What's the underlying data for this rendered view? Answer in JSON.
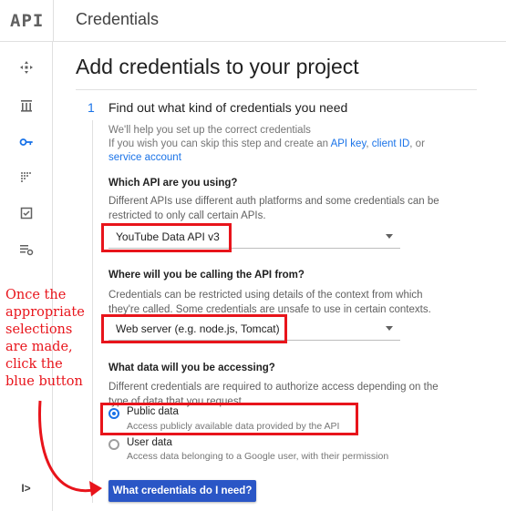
{
  "header": {
    "logo": "API",
    "title": "Credentials"
  },
  "sidebar": {
    "icons": [
      "dashboard-icon",
      "library-icon",
      "key-icon",
      "consent-icon",
      "checkbox-icon",
      "settings-list-icon"
    ],
    "collapse_icon": "collapse-icon",
    "collapse_label": "I>"
  },
  "main": {
    "title": "Add credentials to your project",
    "step": {
      "number": "1",
      "title": "Find out what kind of credentials you need"
    },
    "intro": {
      "line1": "We'll help you set up the correct credentials",
      "line2_prefix": "If you wish you can skip this step and create an",
      "api_key_link": "API key",
      "comma": ",",
      "client_id_link": "client ID",
      "or": ", or",
      "service_account_link": "service account"
    },
    "q1": {
      "label": "Which API are you using?",
      "desc": "Different APIs use different auth platforms and some credentials can be restricted to only call certain APIs.",
      "value": "YouTube Data API v3"
    },
    "q2": {
      "label": "Where will you be calling the API from?",
      "desc": "Credentials can be restricted using details of the context from which they're called. Some credentials are unsafe to use in certain contexts.",
      "value": "Web server (e.g. node.js, Tomcat)"
    },
    "q3": {
      "label": "What data will you be accessing?",
      "desc": "Different credentials are required to authorize access depending on the type of data that you request.",
      "options": [
        {
          "label": "Public data",
          "sub": "Access publicly available data provided by the API",
          "checked": true
        },
        {
          "label": "User data",
          "sub": "Access data belonging to a Google user, with their permission",
          "checked": false
        }
      ]
    },
    "cta_label": "What credentials do I need?"
  },
  "annotation": {
    "text": "Once the appropriate selections are made, click the blue button",
    "color": "#e8141b"
  },
  "colors": {
    "accent": "#1a73e8",
    "button": "#2a56c6",
    "highlight": "#e8141b"
  }
}
